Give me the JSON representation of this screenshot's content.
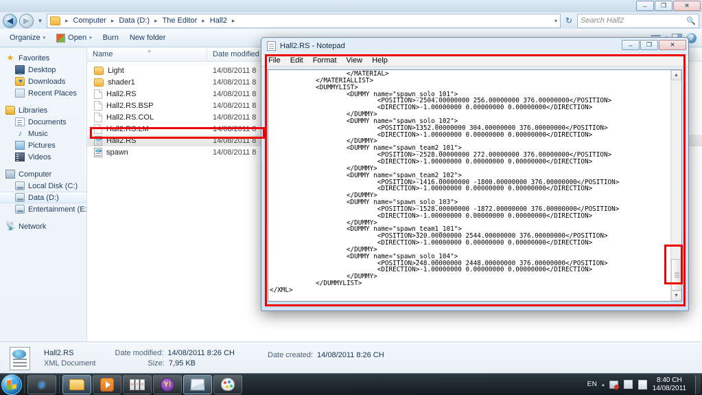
{
  "explorer": {
    "window_controls": {
      "minimize": "–",
      "maximize": "❐",
      "close": "✕"
    },
    "nav": {
      "back": "◀",
      "forward": "▶",
      "history_caret": "▼",
      "refresh": "↻"
    },
    "breadcrumb": {
      "items": [
        "Computer",
        "Data (D:)",
        "The Editor",
        "Hall2"
      ],
      "separator": "▸",
      "caret": "▾"
    },
    "search": {
      "placeholder": "Search Hall2",
      "icon": "search-icon"
    },
    "toolbar": {
      "organize": "Organize",
      "open": "Open",
      "burn": "Burn",
      "new_folder": "New folder",
      "caret": "▾"
    },
    "navpane": {
      "groups": [
        {
          "header": "Favorites",
          "icon": "star-icon",
          "items": [
            {
              "label": "Desktop",
              "icon": "desktop-icon"
            },
            {
              "label": "Downloads",
              "icon": "downloads-icon"
            },
            {
              "label": "Recent Places",
              "icon": "recent-places-icon"
            }
          ]
        },
        {
          "header": "Libraries",
          "icon": "library-icon",
          "items": [
            {
              "label": "Documents",
              "icon": "documents-icon"
            },
            {
              "label": "Music",
              "icon": "music-icon"
            },
            {
              "label": "Pictures",
              "icon": "pictures-icon"
            },
            {
              "label": "Videos",
              "icon": "videos-icon"
            }
          ]
        },
        {
          "header": "Computer",
          "icon": "computer-icon",
          "items": [
            {
              "label": "Local Disk (C:)",
              "icon": "hard-disk-icon",
              "selected": false
            },
            {
              "label": "Data (D:)",
              "icon": "drive-icon",
              "selected": true
            },
            {
              "label": "Entertainment (E:)",
              "icon": "drive-icon",
              "selected": false
            }
          ]
        },
        {
          "header": "Network",
          "icon": "network-icon",
          "items": []
        }
      ]
    },
    "filelist": {
      "columns": [
        "Name",
        "Date modified"
      ],
      "sort_indicator": "▲",
      "rows": [
        {
          "name": "Light",
          "icon": "folder-icon",
          "date": "14/08/2011 8",
          "selected": false
        },
        {
          "name": "shader1",
          "icon": "folder-icon",
          "date": "14/08/2011 8",
          "selected": false
        },
        {
          "name": "Hall2.RS",
          "icon": "file-icon",
          "date": "14/08/2011 8",
          "selected": false
        },
        {
          "name": "Hall2.RS.BSP",
          "icon": "file-icon",
          "date": "14/08/2011 8",
          "selected": false
        },
        {
          "name": "Hall2.RS.COL",
          "icon": "file-icon",
          "date": "14/08/2011 8",
          "selected": false
        },
        {
          "name": "Hall2.RS.LM",
          "icon": "file-icon",
          "date": "14/08/2011 8",
          "selected": false
        },
        {
          "name": "Hall2.RS",
          "icon": "xml-icon",
          "date": "14/08/2011 8",
          "selected": true
        },
        {
          "name": "spawn",
          "icon": "xml-icon",
          "date": "14/08/2011 8",
          "selected": false
        }
      ]
    },
    "details": {
      "file_name": "Hall2.RS",
      "file_type": "XML Document",
      "date_modified_label": "Date modified:",
      "date_modified_value": "14/08/2011 8:26 CH",
      "size_label": "Size:",
      "size_value": "7,95 KB",
      "date_created_label": "Date created:",
      "date_created_value": "14/08/2011 8:26 CH"
    }
  },
  "notepad": {
    "title": "Hall2.RS - Notepad",
    "window_controls": {
      "minimize": "–",
      "maximize": "❐",
      "close": "✕"
    },
    "menus": [
      "File",
      "Edit",
      "Format",
      "View",
      "Help"
    ],
    "scrollbar": {
      "up": "▲",
      "down": "▼",
      "position": "bottom"
    },
    "content": "                    </MATERIAL>\n            </MATERIALLIST>\n            <DUMMYLIST>\n                    <DUMMY name=\"spawn_solo_101\">\n                            <POSITION>-2504.00000000 256.00000000 376.00000000</POSITION>\n                            <DIRECTION>-1.00000000 0.00000000 0.00000000</DIRECTION>\n                    </DUMMY>\n                    <DUMMY name=\"spawn_solo_102\">\n                            <POSITION>1352.00000000 304.00000000 376.00000000</POSITION>\n                            <DIRECTION>-1.00000000 0.00000000 0.00000000</DIRECTION>\n                    </DUMMY>\n                    <DUMMY name=\"spawn_team2_101\">\n                            <POSITION>-2528.00000000 272.00000000 376.00000000</POSITION>\n                            <DIRECTION>-1.00000000 0.00000000 0.00000000</DIRECTION>\n                    </DUMMY>\n                    <DUMMY name=\"spawn_team2_102\">\n                            <POSITION>-1416.00000000 -1800.00000000 376.00000000</POSITION>\n                            <DIRECTION>-1.00000000 0.00000000 0.00000000</DIRECTION>\n                    </DUMMY>\n                    <DUMMY name=\"spawn_solo_103\">\n                            <POSITION>-1528.00000000 -1872.00000000 376.00000000</POSITION>\n                            <DIRECTION>-1.00000000 0.00000000 0.00000000</DIRECTION>\n                    </DUMMY>\n                    <DUMMY name=\"spawn_team1_101\">\n                            <POSITION>320.00000000 2544.00000000 376.00000000</POSITION>\n                            <DIRECTION>-1.00000000 0.00000000 0.00000000</DIRECTION>\n                    </DUMMY>\n                    <DUMMY name=\"spawn_solo_104\">\n                            <POSITION>248.00000000 2448.00000000 376.00000000</POSITION>\n                            <DIRECTION>-1.00000000 0.00000000 0.00000000</DIRECTION>\n                    </DUMMY>\n            </DUMMYLIST>\n</XML>"
  },
  "taskbar": {
    "start_label": "Start",
    "buttons": [
      {
        "name": "internet-explorer",
        "glyph": "e"
      },
      {
        "name": "windows-explorer",
        "glyph": ""
      },
      {
        "name": "windows-media-player",
        "glyph": ""
      },
      {
        "name": "unikey",
        "glyph": ""
      },
      {
        "name": "yahoo-messenger",
        "glyph": "Y!"
      },
      {
        "name": "notepad",
        "glyph": ""
      },
      {
        "name": "paint",
        "glyph": ""
      }
    ],
    "tray": {
      "language": "EN",
      "caret": "▴",
      "time": "8:40 CH",
      "date": "14/08/2011"
    }
  },
  "annotations": {
    "color": "#ef0000",
    "boxes": [
      "selected-file-row",
      "notepad-content-area",
      "notepad-scrollbar-thumb"
    ]
  }
}
